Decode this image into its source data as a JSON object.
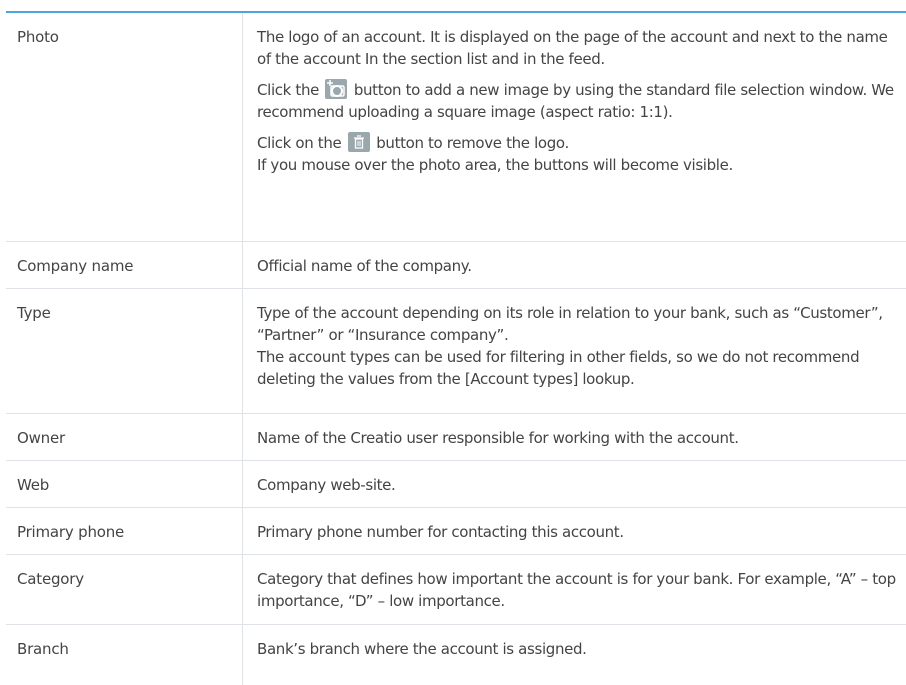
{
  "rows": [
    {
      "field": "Photo",
      "p1": "The logo of an account. It is displayed on the page of the account and next to the name of the account In the section list and in the feed.",
      "p2_before": "Click the",
      "p2_after": "button to add a new image by using the standard file selection window. We recommend uploading a square image (aspect ratio: 1:1).",
      "p3_before": "Click on the",
      "p3_after": "button to remove the logo.",
      "p4": "If you mouse over the photo area, the buttons will become visible."
    },
    {
      "field": "Company name",
      "desc": "Official name of the company."
    },
    {
      "field": "Type",
      "desc": "Type of the account depending on its role in relation to your bank, such as “Customer”, “Partner” or “Insurance company”.",
      "desc2": "The account types can be used for filtering in other fields, so we do not recommend deleting the values from the [Account types] lookup."
    },
    {
      "field": "Owner",
      "desc": "Name of the Creatio user responsible for working with the account."
    },
    {
      "field": "Web",
      "desc": "Company web-site."
    },
    {
      "field": "Primary phone",
      "desc": "Primary phone number for contacting this account."
    },
    {
      "field": "Category",
      "desc": "Category that defines how important the account is for your bank. For example, “A” – top importance, “D” – low importance."
    },
    {
      "field": "Branch",
      "desc": "Bank’s branch where the account is assigned."
    }
  ],
  "colors": {
    "header_line": "#4aa6dc",
    "border": "#dfe3e8",
    "icon_bg": "#9aa7ad"
  },
  "icons": [
    "add-photo-icon",
    "trash-icon"
  ]
}
